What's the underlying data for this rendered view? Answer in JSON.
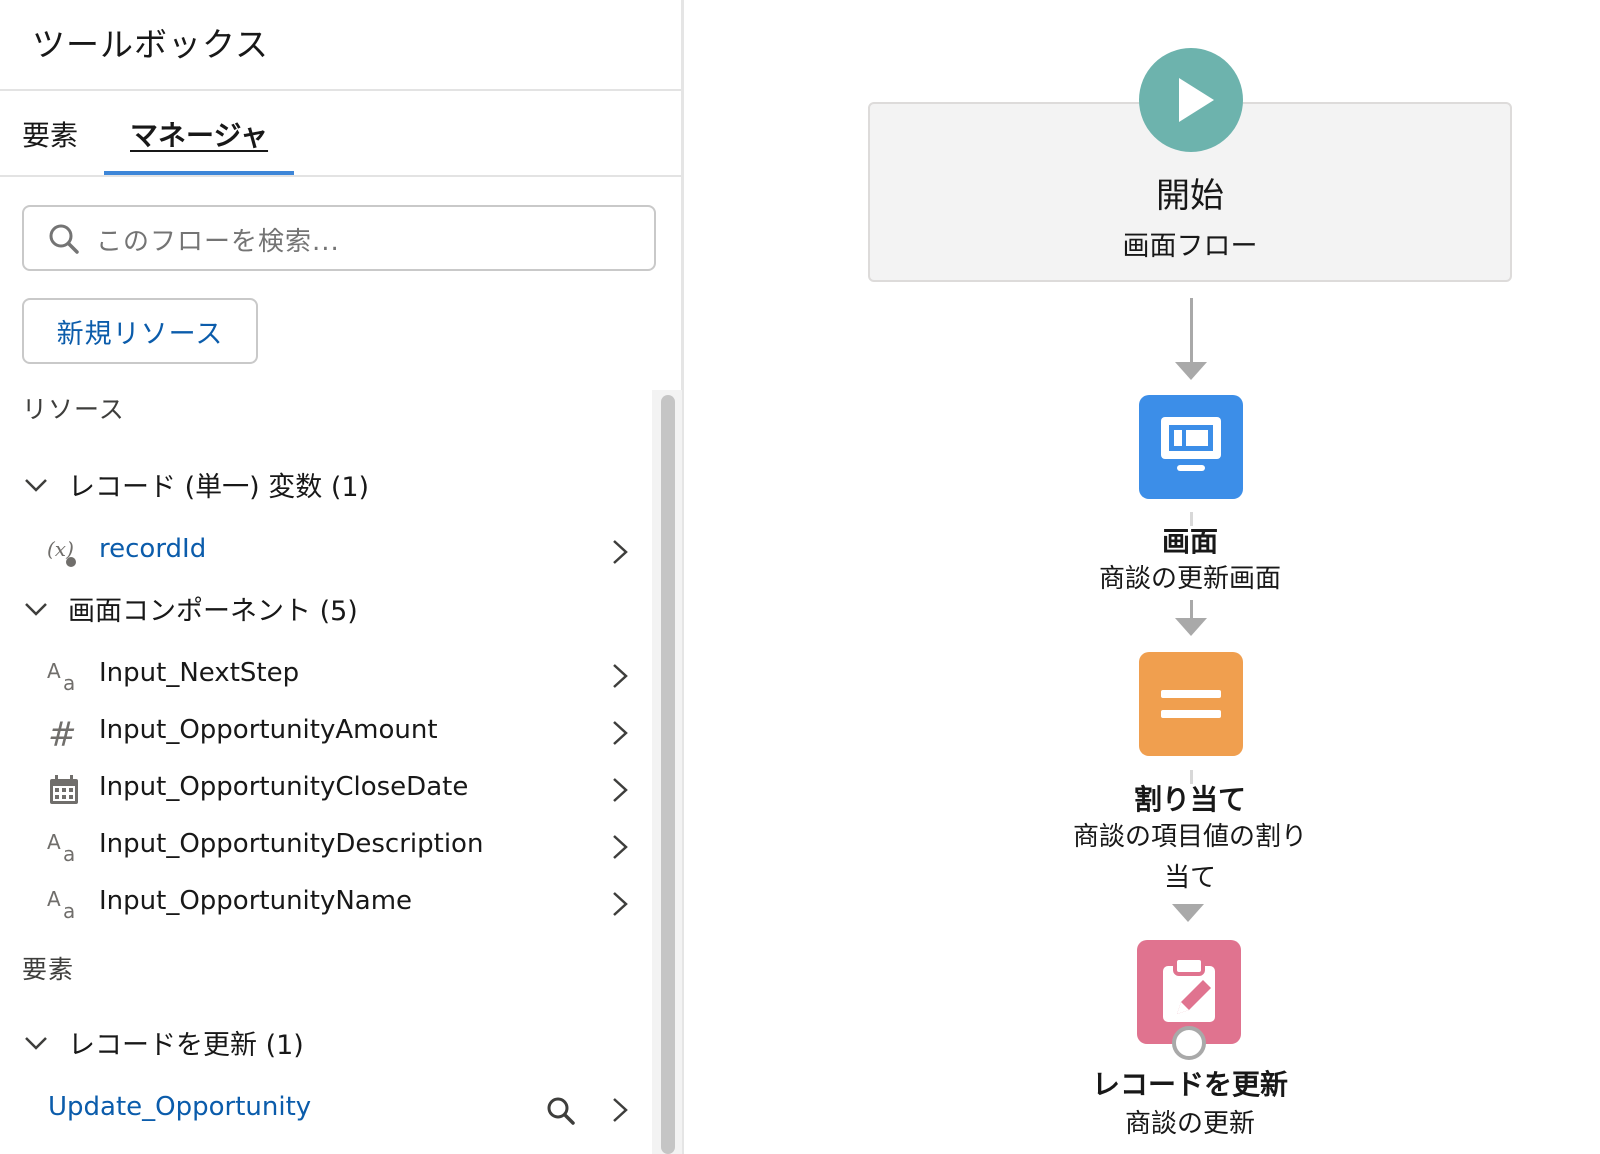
{
  "toolbox": {
    "title": "ツールボックス",
    "tabs": [
      {
        "label": "要素",
        "active": false
      },
      {
        "label": "マネージャ",
        "active": true
      }
    ],
    "search_placeholder": "このフローを検索...",
    "new_resource_label": "新規リソース",
    "resources_label": "リソース",
    "groups": [
      {
        "label": "レコード (単一) 変数 (1)",
        "items": [
          {
            "name": "recordId",
            "icon": "record-variable-icon",
            "link": true
          }
        ]
      },
      {
        "label": "画面コンポーネント (5)",
        "items": [
          {
            "name": "Input_NextStep",
            "icon": "text-icon",
            "link": false
          },
          {
            "name": "Input_OpportunityAmount",
            "icon": "number-icon",
            "link": false
          },
          {
            "name": "Input_OpportunityCloseDate",
            "icon": "date-icon",
            "link": false
          },
          {
            "name": "Input_OpportunityDescription",
            "icon": "text-icon",
            "link": false
          },
          {
            "name": "Input_OpportunityName",
            "icon": "text-icon",
            "link": false
          }
        ]
      }
    ],
    "elements_label": "要素",
    "element_groups": [
      {
        "label": "レコードを更新 (1)",
        "items": [
          {
            "name": "Update_Opportunity",
            "icon": "",
            "link": true
          }
        ]
      }
    ]
  },
  "flow": {
    "start": {
      "title": "開始",
      "subtitle": "画面フロー",
      "color": "#6db3ad"
    },
    "nodes": [
      {
        "type": "画面",
        "label": "商談の更新画面",
        "color": "#3c8ee8",
        "icon": "screen-icon"
      },
      {
        "type": "割り当て",
        "label_line1": "商談の項目値の割り",
        "label_line2": "当て",
        "color": "#f09f4f",
        "icon": "assignment-icon"
      },
      {
        "type": "レコードを更新",
        "label": "商談の更新",
        "color": "#e0738f",
        "icon": "update-records-icon"
      }
    ]
  },
  "colors": {
    "link": "#0b5cab",
    "tab_indicator": "#3d86d8",
    "connector": "#a9a9a9"
  }
}
